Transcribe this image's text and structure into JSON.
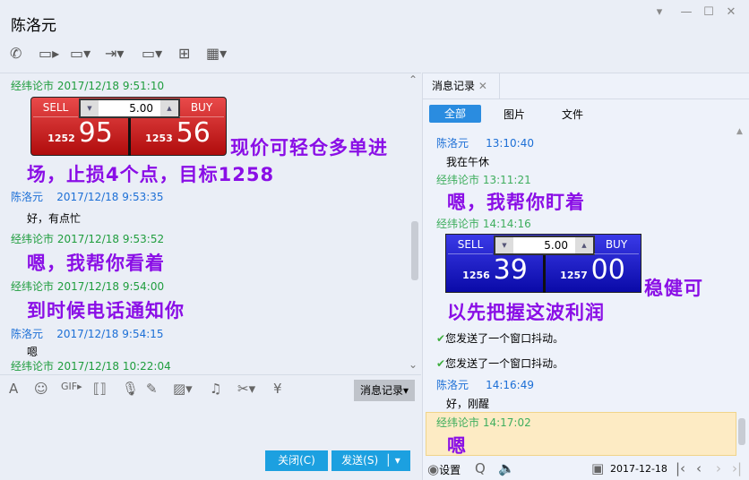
{
  "title": "陈洛元",
  "left_messages": [
    {
      "sender": "经纬论市",
      "time": "2017/12/18 9:51:10"
    },
    {
      "text": "现价可轻仓多单进",
      "text2": "场，止损4个点，目标1258"
    },
    {
      "sender": "陈洛元",
      "time": "2017/12/18 9:53:35",
      "text": "好，有点忙"
    },
    {
      "sender": "经纬论市",
      "time": "2017/12/18 9:53:52",
      "text": "嗯，我帮你看着"
    },
    {
      "sender": "经纬论市",
      "time": "2017/12/18 9:54:00",
      "text": "到时候电话通知你"
    },
    {
      "sender": "陈洛元",
      "time": "2017/12/18 9:54:15",
      "text": "嗯"
    },
    {
      "sender": "经纬论市",
      "time": "2017/12/18 10:22:04"
    }
  ],
  "widget_red": {
    "sell": "SELL",
    "buy": "BUY",
    "qty": "5.00",
    "sell_small": "1252",
    "sell_big": "95",
    "buy_small": "1253",
    "buy_big": "56"
  },
  "widget_blue": {
    "sell": "SELL",
    "buy": "BUY",
    "qty": "5.00",
    "sell_small": "1256",
    "sell_big": "39",
    "buy_small": "1257",
    "buy_big": "00"
  },
  "history_label": "消息记录",
  "close_label": "关闭(C)",
  "send_label": "发送(S)",
  "right": {
    "tab": "消息记录",
    "filters": [
      "全部",
      "图片",
      "文件"
    ],
    "messages": [
      {
        "sender": "陈洛元",
        "time": "13:10:40",
        "text": "我在午休"
      },
      {
        "sender": "经纬论市",
        "time": "13:11:21",
        "text": "嗯，我帮你盯着"
      },
      {
        "sender": "经纬论市",
        "time": "14:14:16",
        "text": "稳健可",
        "text2": "以先把握这波利润"
      },
      {
        "shake": "您发送了一个窗口抖动。"
      },
      {
        "shake": "您发送了一个窗口抖动。"
      },
      {
        "sender": "陈洛元",
        "time": "14:16:49",
        "text": "好，刚醒"
      },
      {
        "sender": "经纬论市",
        "time": "14:17:02",
        "text": "嗯"
      }
    ],
    "settings": "设置",
    "date": "2017-12-18"
  }
}
